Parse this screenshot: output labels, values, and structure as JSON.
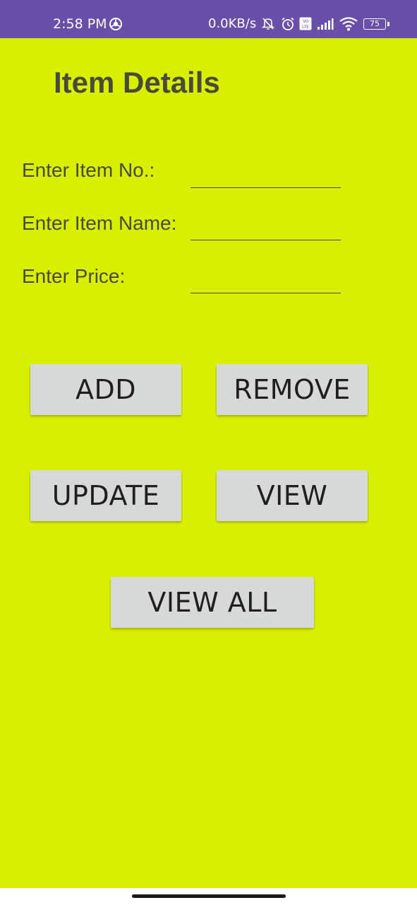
{
  "status_bar": {
    "time": "2:58 PM",
    "network_speed": "0.0KB/s",
    "battery_level": "75",
    "icons": [
      "chrome-icon",
      "mute-bell-icon",
      "alarm-icon",
      "volte-icon",
      "signal-icon",
      "wifi-icon",
      "battery-icon"
    ]
  },
  "colors": {
    "status_bar": "#6a4fa8",
    "background": "#d8f000",
    "button": "#d7d9d9",
    "text": "#4a4a3a"
  },
  "page": {
    "title": "Item Details"
  },
  "form": {
    "item_no_label": "Enter Item No.:",
    "item_no_value": "",
    "item_name_label": "Enter Item Name:",
    "item_name_value": "",
    "price_label": "Enter Price:",
    "price_value": ""
  },
  "buttons": {
    "add": "ADD",
    "remove": "REMOVE",
    "update": "UPDATE",
    "view": "VIEW",
    "view_all": "VIEW ALL"
  }
}
